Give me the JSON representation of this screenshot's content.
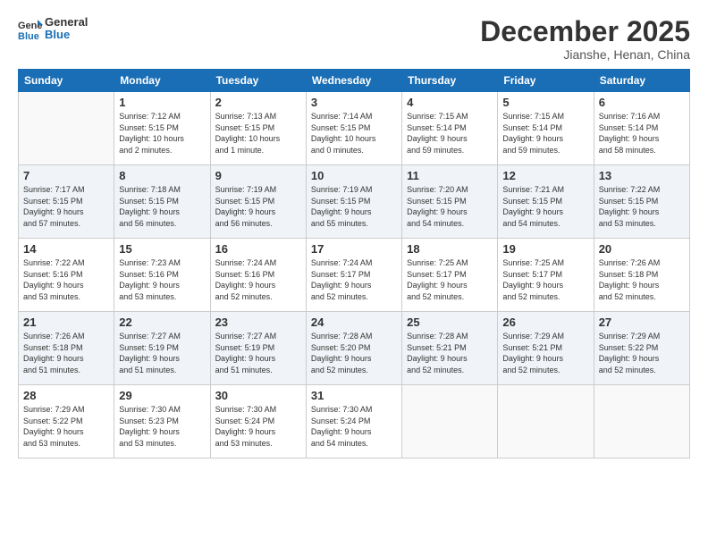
{
  "header": {
    "logo_line1": "General",
    "logo_line2": "Blue",
    "month_title": "December 2025",
    "location": "Jianshe, Henan, China"
  },
  "days_of_week": [
    "Sunday",
    "Monday",
    "Tuesday",
    "Wednesday",
    "Thursday",
    "Friday",
    "Saturday"
  ],
  "weeks": [
    [
      {
        "day": "",
        "info": ""
      },
      {
        "day": "1",
        "info": "Sunrise: 7:12 AM\nSunset: 5:15 PM\nDaylight: 10 hours\nand 2 minutes."
      },
      {
        "day": "2",
        "info": "Sunrise: 7:13 AM\nSunset: 5:15 PM\nDaylight: 10 hours\nand 1 minute."
      },
      {
        "day": "3",
        "info": "Sunrise: 7:14 AM\nSunset: 5:15 PM\nDaylight: 10 hours\nand 0 minutes."
      },
      {
        "day": "4",
        "info": "Sunrise: 7:15 AM\nSunset: 5:14 PM\nDaylight: 9 hours\nand 59 minutes."
      },
      {
        "day": "5",
        "info": "Sunrise: 7:15 AM\nSunset: 5:14 PM\nDaylight: 9 hours\nand 59 minutes."
      },
      {
        "day": "6",
        "info": "Sunrise: 7:16 AM\nSunset: 5:14 PM\nDaylight: 9 hours\nand 58 minutes."
      }
    ],
    [
      {
        "day": "7",
        "info": "Sunrise: 7:17 AM\nSunset: 5:15 PM\nDaylight: 9 hours\nand 57 minutes."
      },
      {
        "day": "8",
        "info": "Sunrise: 7:18 AM\nSunset: 5:15 PM\nDaylight: 9 hours\nand 56 minutes."
      },
      {
        "day": "9",
        "info": "Sunrise: 7:19 AM\nSunset: 5:15 PM\nDaylight: 9 hours\nand 56 minutes."
      },
      {
        "day": "10",
        "info": "Sunrise: 7:19 AM\nSunset: 5:15 PM\nDaylight: 9 hours\nand 55 minutes."
      },
      {
        "day": "11",
        "info": "Sunrise: 7:20 AM\nSunset: 5:15 PM\nDaylight: 9 hours\nand 54 minutes."
      },
      {
        "day": "12",
        "info": "Sunrise: 7:21 AM\nSunset: 5:15 PM\nDaylight: 9 hours\nand 54 minutes."
      },
      {
        "day": "13",
        "info": "Sunrise: 7:22 AM\nSunset: 5:15 PM\nDaylight: 9 hours\nand 53 minutes."
      }
    ],
    [
      {
        "day": "14",
        "info": "Sunrise: 7:22 AM\nSunset: 5:16 PM\nDaylight: 9 hours\nand 53 minutes."
      },
      {
        "day": "15",
        "info": "Sunrise: 7:23 AM\nSunset: 5:16 PM\nDaylight: 9 hours\nand 53 minutes."
      },
      {
        "day": "16",
        "info": "Sunrise: 7:24 AM\nSunset: 5:16 PM\nDaylight: 9 hours\nand 52 minutes."
      },
      {
        "day": "17",
        "info": "Sunrise: 7:24 AM\nSunset: 5:17 PM\nDaylight: 9 hours\nand 52 minutes."
      },
      {
        "day": "18",
        "info": "Sunrise: 7:25 AM\nSunset: 5:17 PM\nDaylight: 9 hours\nand 52 minutes."
      },
      {
        "day": "19",
        "info": "Sunrise: 7:25 AM\nSunset: 5:17 PM\nDaylight: 9 hours\nand 52 minutes."
      },
      {
        "day": "20",
        "info": "Sunrise: 7:26 AM\nSunset: 5:18 PM\nDaylight: 9 hours\nand 52 minutes."
      }
    ],
    [
      {
        "day": "21",
        "info": "Sunrise: 7:26 AM\nSunset: 5:18 PM\nDaylight: 9 hours\nand 51 minutes."
      },
      {
        "day": "22",
        "info": "Sunrise: 7:27 AM\nSunset: 5:19 PM\nDaylight: 9 hours\nand 51 minutes."
      },
      {
        "day": "23",
        "info": "Sunrise: 7:27 AM\nSunset: 5:19 PM\nDaylight: 9 hours\nand 51 minutes."
      },
      {
        "day": "24",
        "info": "Sunrise: 7:28 AM\nSunset: 5:20 PM\nDaylight: 9 hours\nand 52 minutes."
      },
      {
        "day": "25",
        "info": "Sunrise: 7:28 AM\nSunset: 5:21 PM\nDaylight: 9 hours\nand 52 minutes."
      },
      {
        "day": "26",
        "info": "Sunrise: 7:29 AM\nSunset: 5:21 PM\nDaylight: 9 hours\nand 52 minutes."
      },
      {
        "day": "27",
        "info": "Sunrise: 7:29 AM\nSunset: 5:22 PM\nDaylight: 9 hours\nand 52 minutes."
      }
    ],
    [
      {
        "day": "28",
        "info": "Sunrise: 7:29 AM\nSunset: 5:22 PM\nDaylight: 9 hours\nand 53 minutes."
      },
      {
        "day": "29",
        "info": "Sunrise: 7:30 AM\nSunset: 5:23 PM\nDaylight: 9 hours\nand 53 minutes."
      },
      {
        "day": "30",
        "info": "Sunrise: 7:30 AM\nSunset: 5:24 PM\nDaylight: 9 hours\nand 53 minutes."
      },
      {
        "day": "31",
        "info": "Sunrise: 7:30 AM\nSunset: 5:24 PM\nDaylight: 9 hours\nand 54 minutes."
      },
      {
        "day": "",
        "info": ""
      },
      {
        "day": "",
        "info": ""
      },
      {
        "day": "",
        "info": ""
      }
    ]
  ]
}
